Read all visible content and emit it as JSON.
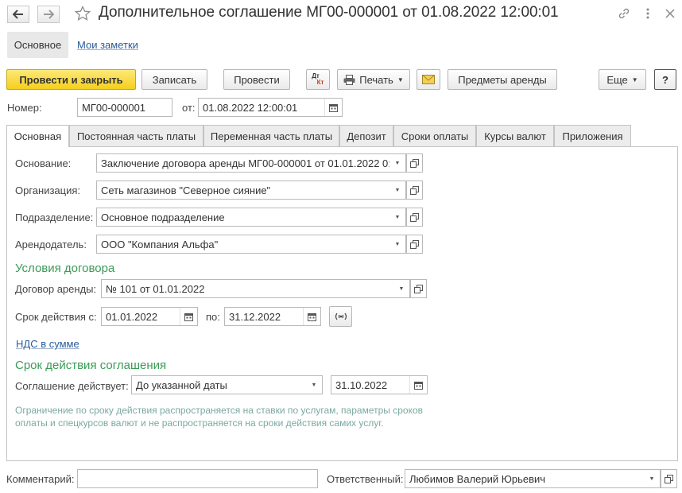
{
  "window": {
    "title": "Дополнительное соглашение МГ00-000001 от 01.08.2022 12:00:01"
  },
  "sections": {
    "main": "Основное",
    "notes": "Мои заметки"
  },
  "toolbar": {
    "post_close": "Провести и закрыть",
    "write": "Записать",
    "post": "Провести",
    "dtkt_top": "Дт",
    "dtkt_bottom": "Кт",
    "print": "Печать",
    "lease_items": "Предметы аренды",
    "more": "Еще",
    "help": "?"
  },
  "header": {
    "number_label": "Номер:",
    "number_value": "МГ00-000001",
    "date_label": "от:",
    "date_value": "01.08.2022 12:00:01"
  },
  "tabs": [
    "Основная",
    "Постоянная часть платы",
    "Переменная часть платы",
    "Депозит",
    "Сроки оплаты",
    "Курсы валют",
    "Приложения"
  ],
  "form": {
    "basis_label": "Основание:",
    "basis_value": "Заключение договора аренды МГ00-000001 от 01.01.2022 0:",
    "org_label": "Организация:",
    "org_value": "Сеть магазинов \"Северное сияние\"",
    "dept_label": "Подразделение:",
    "dept_value": "Основное подразделение",
    "landlord_label": "Арендодатель:",
    "landlord_value": "ООО \"Компания Альфа\"",
    "contract_terms_title": "Условия договора",
    "lease_contract_label": "Договор аренды:",
    "lease_contract_value": "№ 101 от 01.01.2022",
    "period_from_label": "Срок действия с:",
    "period_from_value": "01.01.2022",
    "period_to_label": "по:",
    "period_to_value": "31.12.2022",
    "vat_link": "НДС в сумме",
    "agreement_period_title": "Срок действия соглашения",
    "agreement_valid_label": "Соглашение действует:",
    "agreement_valid_value": "До указанной даты",
    "agreement_date_value": "31.10.2022",
    "info_text": "Ограничение по сроку действия распространяется на ставки по услугам, параметры сроков оплаты и спецкурсов валют и не распространяется на сроки действия самих услуг."
  },
  "footer": {
    "comment_label": "Комментарий:",
    "comment_value": "",
    "responsible_label": "Ответственный:",
    "responsible_value": "Любимов Валерий Юрьевич"
  },
  "colors": {
    "primary_button": "#f5cf1d",
    "group_title": "#3c9a57",
    "link": "#2a5a9c",
    "info_text": "#7aa9a0"
  },
  "icons": [
    "back-arrow-icon",
    "forward-arrow-icon",
    "star-icon",
    "link-icon",
    "more-vertical-icon",
    "close-icon",
    "printer-icon",
    "envelope-icon",
    "calendar-icon",
    "open-form-icon",
    "period-select-icon"
  ]
}
